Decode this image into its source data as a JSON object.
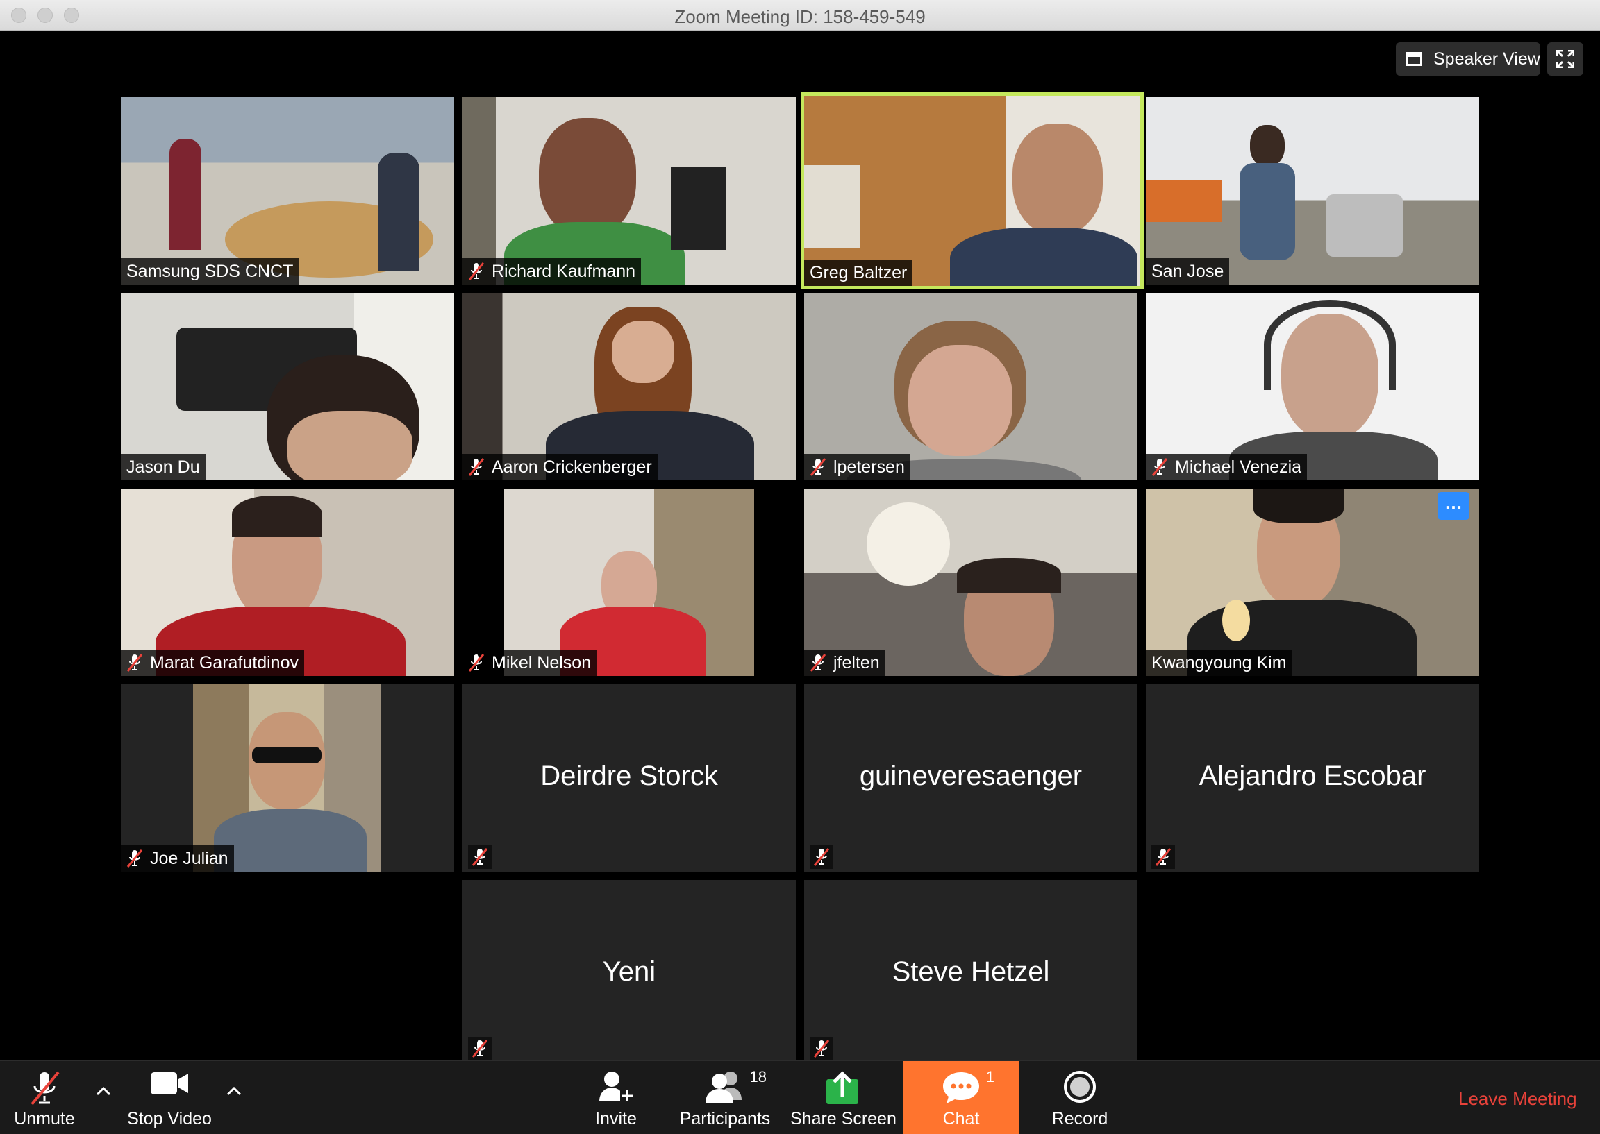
{
  "window": {
    "title": "Zoom Meeting ID: 158-459-549"
  },
  "view_controls": {
    "speaker_view_label": "Speaker View"
  },
  "participants_grid": [
    {
      "name": "Samsung SDS CNCT",
      "muted": false,
      "video": true,
      "active": false,
      "scene": "conference-room"
    },
    {
      "name": "Richard Kaufmann",
      "muted": true,
      "video": true,
      "active": false,
      "scene": "home-office"
    },
    {
      "name": "Greg Baltzer",
      "muted": false,
      "video": true,
      "active": true,
      "scene": "wood-office"
    },
    {
      "name": "San Jose",
      "muted": false,
      "video": true,
      "active": false,
      "scene": "office"
    },
    {
      "name": "Jason Du",
      "muted": false,
      "video": true,
      "active": false,
      "scene": "living-room"
    },
    {
      "name": "Aaron Crickenberger",
      "muted": true,
      "video": true,
      "active": false,
      "scene": "home"
    },
    {
      "name": "lpetersen",
      "muted": true,
      "video": true,
      "active": false,
      "scene": "plain-wall"
    },
    {
      "name": "Michael Venezia",
      "muted": true,
      "video": true,
      "active": false,
      "scene": "bright-room"
    },
    {
      "name": "Marat Garafutdinov",
      "muted": true,
      "video": true,
      "active": false,
      "scene": "home"
    },
    {
      "name": "Mikel Nelson",
      "muted": true,
      "video": true,
      "active": false,
      "scene": "home"
    },
    {
      "name": "jfelten",
      "muted": true,
      "video": true,
      "active": false,
      "scene": "couch"
    },
    {
      "name": "Kwangyoung Kim",
      "muted": false,
      "video": true,
      "active": false,
      "scene": "living-room",
      "has_more_button": true
    },
    {
      "name": "Joe Julian",
      "muted": true,
      "video": true,
      "active": false,
      "scene": "street"
    },
    {
      "name": "Deirdre Storck",
      "muted": true,
      "video": false,
      "active": false
    },
    {
      "name": "guineveresaenger",
      "muted": true,
      "video": false,
      "active": false
    },
    {
      "name": "Alejandro Escobar",
      "muted": true,
      "video": false,
      "active": false
    },
    {
      "name": "Yeni",
      "muted": true,
      "video": false,
      "active": false
    },
    {
      "name": "Steve Hetzel",
      "muted": true,
      "video": false,
      "active": false
    }
  ],
  "toolbar": {
    "unmute_label": "Unmute",
    "stop_video_label": "Stop Video",
    "invite_label": "Invite",
    "participants_label": "Participants",
    "participants_count": "18",
    "share_screen_label": "Share Screen",
    "chat_label": "Chat",
    "chat_badge": "1",
    "record_label": "Record",
    "leave_label": "Leave Meeting"
  },
  "colors": {
    "active_speaker": "#c5e85d",
    "chat_accent": "#ff742e",
    "leave": "#e8423a",
    "share": "#2bb34a"
  }
}
